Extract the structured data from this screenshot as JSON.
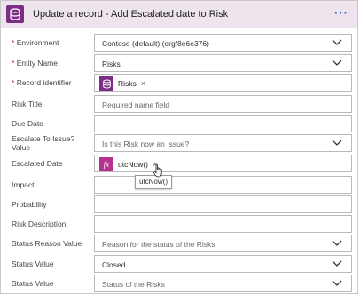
{
  "header": {
    "title": "Update a record - Add Escalated date to Risk",
    "more_label": "···"
  },
  "fields": [
    {
      "label": "Environment",
      "required": true,
      "value": "Contoso (default) (orgf8e6e376)",
      "dropdown": true
    },
    {
      "label": "Entity Name",
      "required": true,
      "value": "Risks",
      "dropdown": true
    },
    {
      "label": "Record identifier",
      "required": true,
      "token": {
        "label": "Risks",
        "icon": "database-icon"
      }
    },
    {
      "label": "Risk Title",
      "placeholder": "Required name field"
    },
    {
      "label": "Due Date",
      "value": ""
    },
    {
      "label": "Escalate To Issue? Value",
      "placeholder": "Is this Risk now an Issue?",
      "dropdown": true
    },
    {
      "label": "Escalated Date",
      "token": {
        "label": "utcNow()",
        "icon": "fx-icon"
      }
    },
    {
      "label": "Impact",
      "value": ""
    },
    {
      "label": "Probability",
      "value": ""
    },
    {
      "label": "Risk Description",
      "value": ""
    },
    {
      "label": "Status Reason Value",
      "placeholder": "Reason for the status of the Risks",
      "dropdown": true
    },
    {
      "label": "Status Value",
      "value": "Closed",
      "dropdown": true
    },
    {
      "label": "Status Value",
      "placeholder": "Status of the Risks",
      "dropdown": true
    }
  ],
  "tooltip": "utcNow()",
  "required_marker": "*",
  "token_remove": "×",
  "fx_glyph": "fx",
  "colors": {
    "header_bg": "#ede4ee",
    "accent_purple": "#7b2e84",
    "fx_pink": "#b5318f",
    "link_blue": "#2f6fc4",
    "required_red": "#c4262e"
  }
}
